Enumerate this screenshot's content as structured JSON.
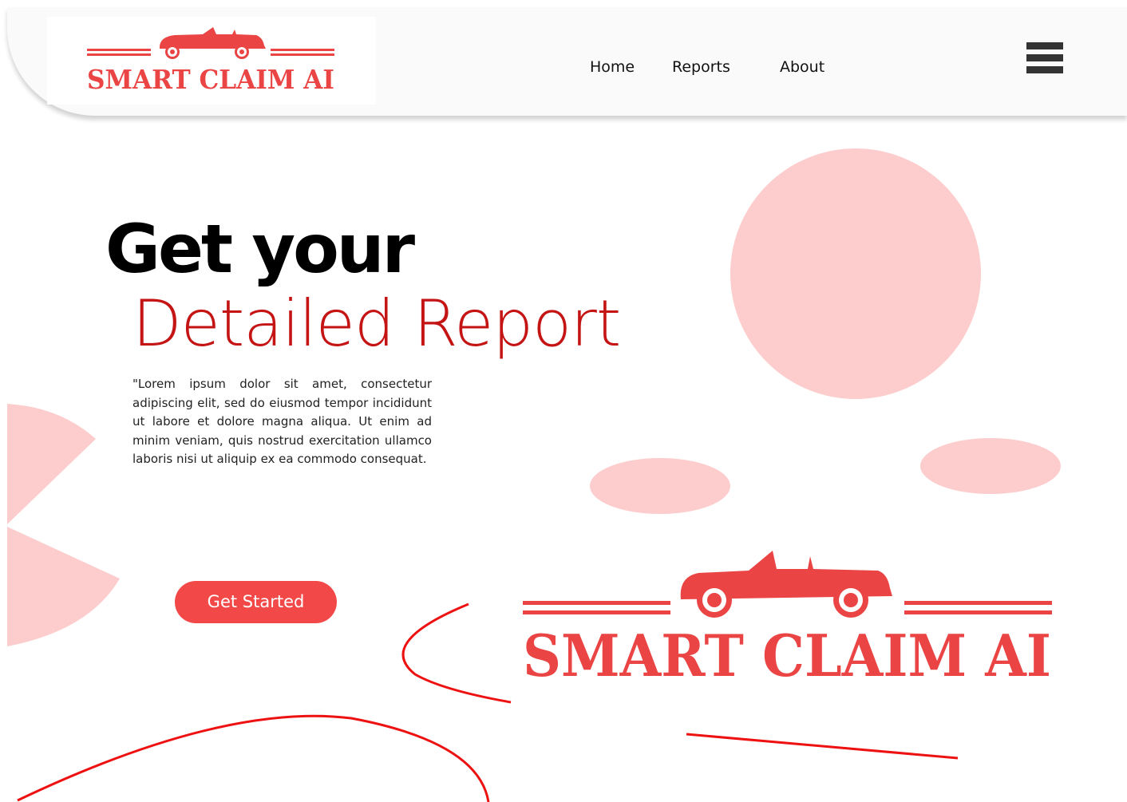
{
  "header": {
    "logo_text": "SMART CLAIM AI",
    "nav": {
      "home": "Home",
      "reports": "Reports",
      "about": "About"
    },
    "menu_icon": "hamburger-menu-icon"
  },
  "hero": {
    "title": "Get your",
    "subtitle": "Detailed Report",
    "body": "\"Lorem ipsum dolor sit amet, consectetur adipiscing elit, sed do eiusmod tempor incididunt ut labore et dolore magna aliqua. Ut enim ad minim veniam, quis nostrud exercitation ullamco laboris nisi ut aliquip ex ea commodo consequat.",
    "cta_label": "Get Started"
  },
  "brand_logo": {
    "text": "SMART CLAIM AI",
    "icon": "convertible-car-icon"
  },
  "colors": {
    "brand_red": "#ea4444",
    "title_red": "#c41414",
    "cta_red": "#f24848",
    "shape_pink": "#fdcccc",
    "line_red": "#ee1111",
    "header_bg": "#fafafa"
  }
}
